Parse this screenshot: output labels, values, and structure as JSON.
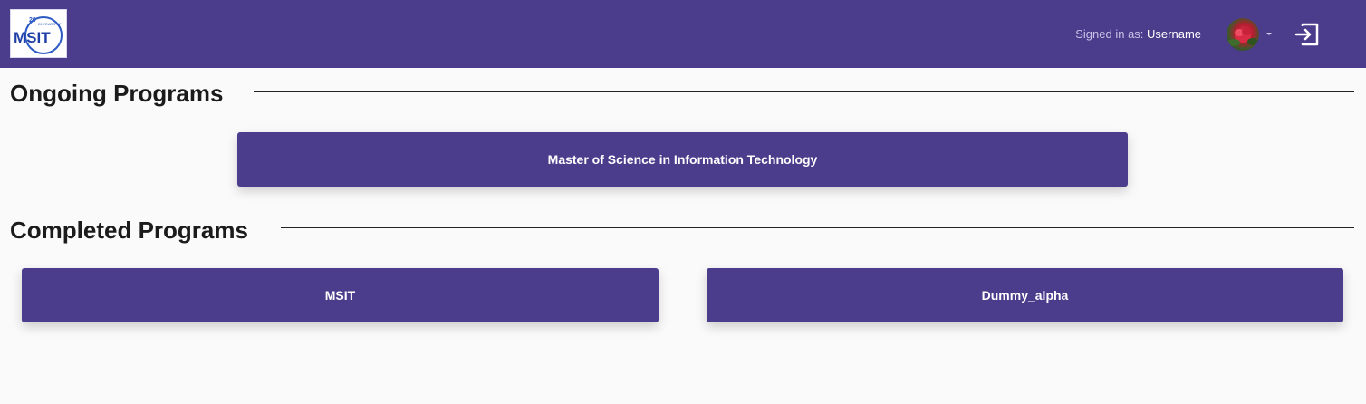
{
  "header": {
    "logo_text": "MSIT",
    "logo_badge": "20 YEARS OF",
    "signed_in_prefix": "Signed in as: ",
    "username": "Username",
    "avatar_icon": "user-avatar",
    "logout_icon": "logout-icon",
    "colors": {
      "background": "#4b3c8c",
      "muted_text": "#c9c2e6",
      "text": "#ffffff"
    }
  },
  "sections": {
    "ongoing": {
      "title": "Ongoing Programs",
      "programs": [
        {
          "label": "Master of Science in Information Technology"
        }
      ]
    },
    "completed": {
      "title": "Completed Programs",
      "programs": [
        {
          "label": "MSIT"
        },
        {
          "label": "Dummy_alpha"
        }
      ]
    }
  },
  "colors": {
    "card": "#4b3c8c",
    "page_background": "#fafafa",
    "heading": "#1b1b1b"
  }
}
